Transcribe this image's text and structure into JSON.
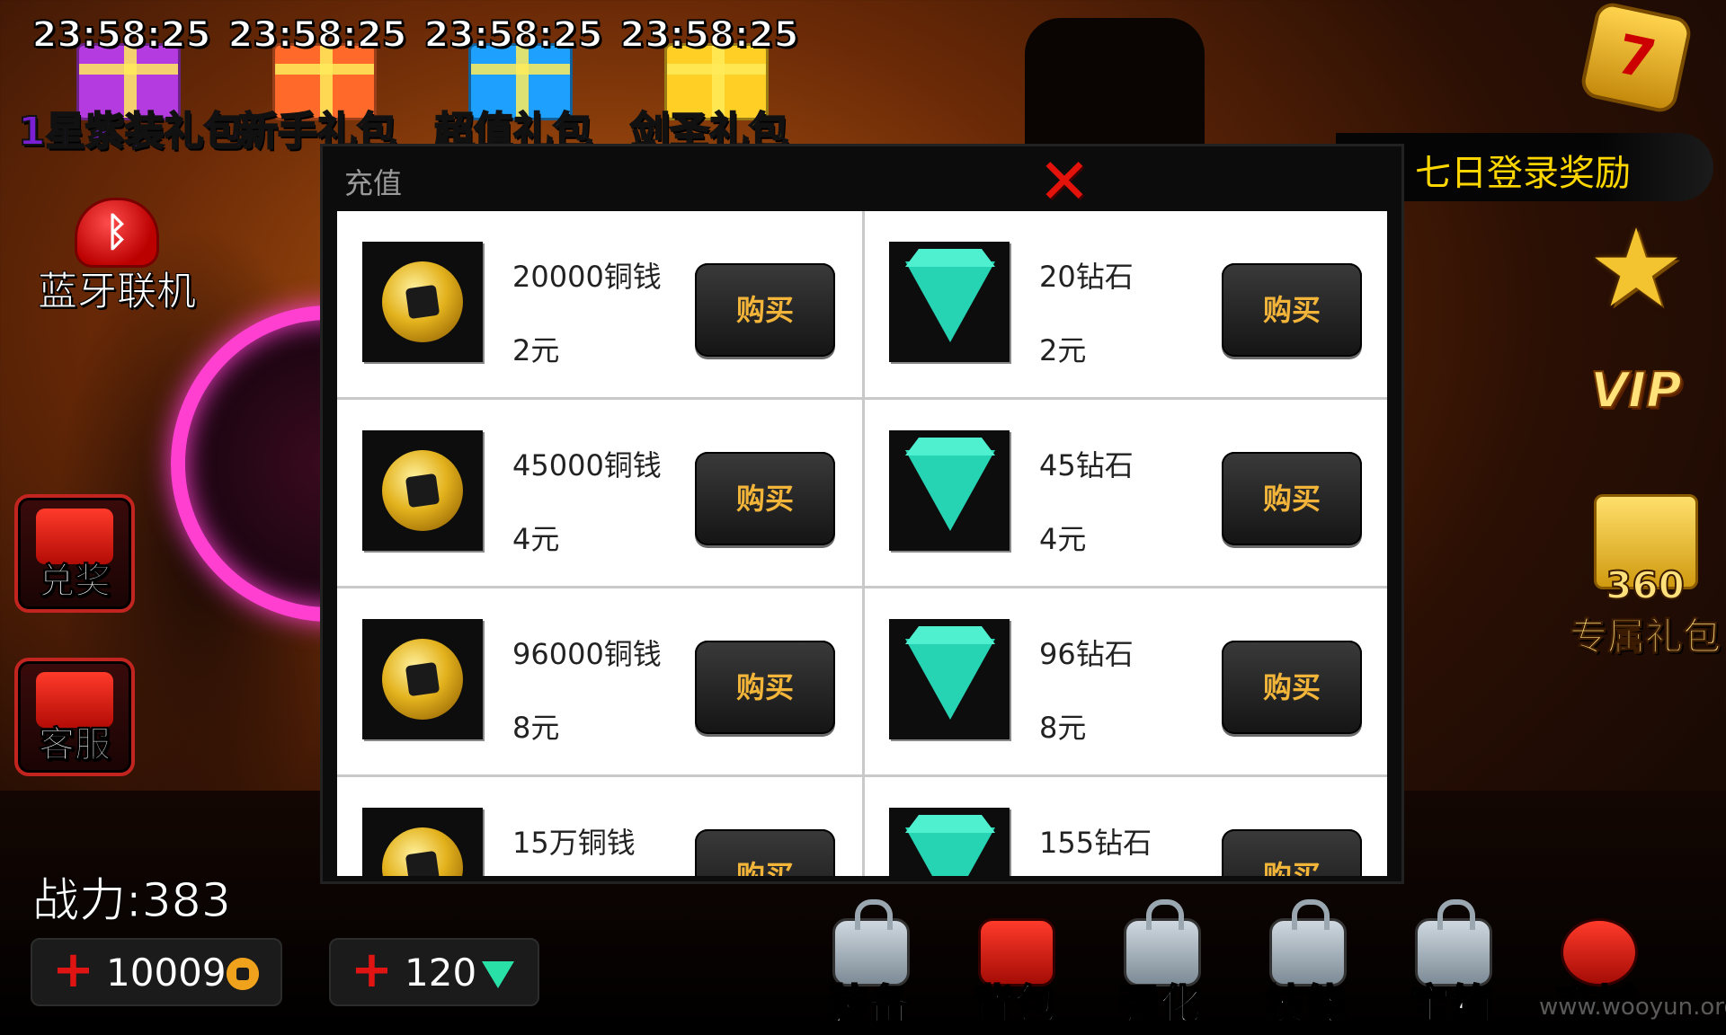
{
  "gift_packs": [
    {
      "timer": "23:58:25",
      "label": "1星紫装礼包",
      "label_color": "#7a1fd1",
      "box_color": "#b43be0"
    },
    {
      "timer": "23:58:25",
      "label": "新手礼包",
      "label_color": "#e0281e",
      "box_color": "#ff6a2a"
    },
    {
      "timer": "23:58:25",
      "label": "超值礼包",
      "label_color": "#2b86e8",
      "box_color": "#1ea0ff"
    },
    {
      "timer": "23:58:25",
      "label": "剑圣礼包",
      "label_color": "#f2c12e",
      "box_color": "#ffcf26"
    }
  ],
  "bluetooth": {
    "label": "蓝牙联机",
    "icon": "bluetooth-icon"
  },
  "side_buttons": {
    "redeem": {
      "label": "兑奖",
      "icon": "gift-box-icon"
    },
    "service": {
      "label": "客服",
      "icon": "envelope-icon"
    }
  },
  "login_reward": {
    "label": "七日登录奖励",
    "badge": "7"
  },
  "vip": {
    "label": "VIP"
  },
  "gift360": {
    "num": "360",
    "label": "专属礼包"
  },
  "dialog": {
    "title": "充值",
    "close_icon": "close-x-icon",
    "buy_label": "购买",
    "rows": [
      {
        "coin": {
          "name": "20000铜钱",
          "price": "2元"
        },
        "gem": {
          "name": "20钻石",
          "price": "2元"
        }
      },
      {
        "coin": {
          "name": "45000铜钱",
          "price": "4元"
        },
        "gem": {
          "name": "45钻石",
          "price": "4元"
        }
      },
      {
        "coin": {
          "name": "96000铜钱",
          "price": "8元"
        },
        "gem": {
          "name": "96钻石",
          "price": "8元"
        }
      },
      {
        "coin": {
          "name": "15万铜钱",
          "price": ""
        },
        "gem": {
          "name": "155钻石",
          "price": ""
        }
      }
    ]
  },
  "stats": {
    "power": "战力:383",
    "coins": "10009",
    "gems": "120"
  },
  "bottom_nav": [
    {
      "label": "装备",
      "icon": "locked-icon",
      "locked": true
    },
    {
      "label": "背包",
      "icon": "backpack-icon",
      "locked": false
    },
    {
      "label": "强化",
      "icon": "locked-icon",
      "locked": true
    },
    {
      "label": "技能",
      "icon": "locked-icon",
      "locked": true
    },
    {
      "label": "宝箱",
      "icon": "locked-icon",
      "locked": true
    },
    {
      "label": "商城",
      "icon": "shop-gem-icon",
      "locked": false
    }
  ],
  "watermark": "www.wooyun.org"
}
